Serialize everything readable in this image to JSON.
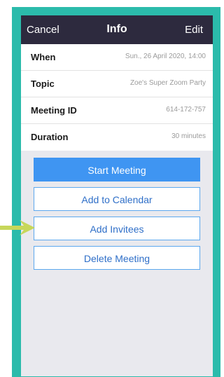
{
  "colors": {
    "frame": "#2bbbab",
    "navbar": "#2d2a3e",
    "background": "#e9e9ee",
    "primary_button": "#3f95f2",
    "arrow": "#c7d75a"
  },
  "navbar": {
    "cancel": "Cancel",
    "title": "Info",
    "edit": "Edit"
  },
  "details": [
    {
      "label": "When",
      "value": "Sun., 26 April 2020, 14:00"
    },
    {
      "label": "Topic",
      "value": "Zoe's Super Zoom Party"
    },
    {
      "label": "Meeting ID",
      "value": "614-172-757"
    },
    {
      "label": "Duration",
      "value": "30 minutes"
    }
  ],
  "actions": {
    "start": "Start Meeting",
    "calendar": "Add to Calendar",
    "invitees": "Add Invitees",
    "delete": "Delete Meeting"
  },
  "annotation": {
    "icon": "arrow-right-icon"
  }
}
